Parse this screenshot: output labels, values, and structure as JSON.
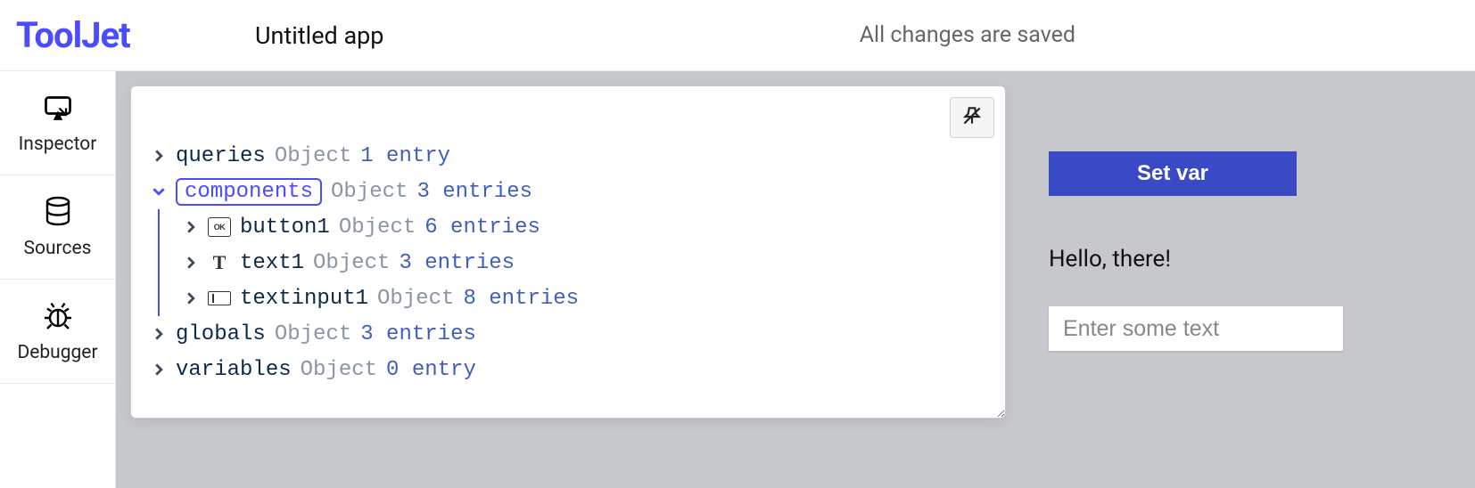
{
  "header": {
    "logo": "ToolJet",
    "app_title": "Untitled app",
    "save_status": "All changes are saved"
  },
  "sidebar": {
    "items": [
      {
        "label": "Inspector"
      },
      {
        "label": "Sources"
      },
      {
        "label": "Debugger"
      }
    ]
  },
  "inspector": {
    "nodes": [
      {
        "key": "queries",
        "type": "Object",
        "entries": "1 entry"
      },
      {
        "key": "components",
        "type": "Object",
        "entries": "3 entries"
      },
      {
        "key": "globals",
        "type": "Object",
        "entries": "3 entries"
      },
      {
        "key": "variables",
        "type": "Object",
        "entries": "0 entry"
      }
    ],
    "components_children": [
      {
        "key": "button1",
        "type": "Object",
        "entries": "6 entries"
      },
      {
        "key": "text1",
        "type": "Object",
        "entries": "3 entries"
      },
      {
        "key": "textinput1",
        "type": "Object",
        "entries": "8 entries"
      }
    ]
  },
  "preview": {
    "button_label": "Set var",
    "text_label": "Hello, there!",
    "input_placeholder": "Enter some text"
  }
}
